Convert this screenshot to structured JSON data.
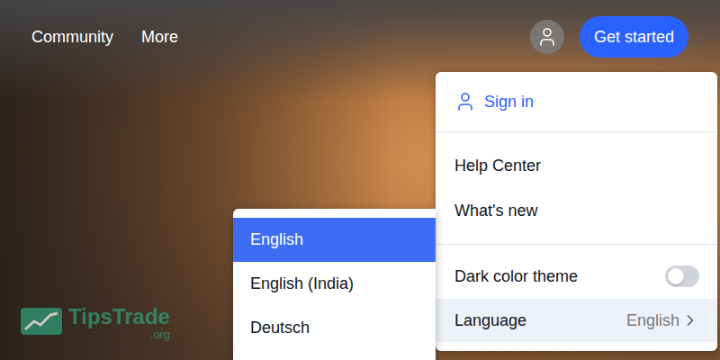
{
  "nav": {
    "links": [
      "Community",
      "More"
    ],
    "cta": "Get started"
  },
  "menu": {
    "sign_in": "Sign in",
    "items": [
      {
        "label": "Help Center"
      },
      {
        "label": "What's new"
      }
    ],
    "settings": [
      {
        "kind": "toggle",
        "label": "Dark color theme",
        "on": false,
        "highlighted": false
      },
      {
        "kind": "submenu",
        "label": "Language",
        "value": "English",
        "highlighted": true
      }
    ]
  },
  "languages": [
    {
      "label": "English",
      "selected": true
    },
    {
      "label": "English (India)",
      "selected": false
    },
    {
      "label": "Deutsch",
      "selected": false
    }
  ],
  "watermark": {
    "name": "TipsTrade",
    "suffix": ".org"
  }
}
